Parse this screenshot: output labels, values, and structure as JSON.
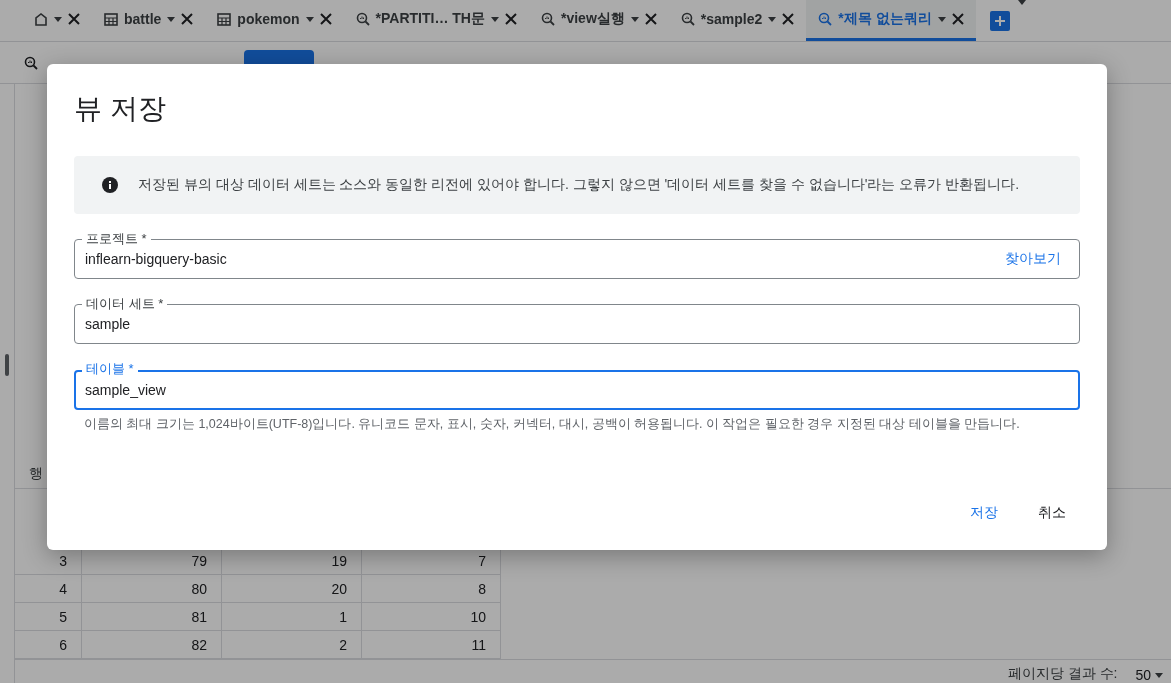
{
  "tabs": [
    {
      "kind": "home",
      "selected": false
    },
    {
      "kind": "table",
      "label": "battle",
      "selected": false
    },
    {
      "kind": "table",
      "label": "pokemon",
      "selected": false
    },
    {
      "kind": "query",
      "label": "*PARTITI… TH문",
      "selected": false
    },
    {
      "kind": "query",
      "label": "*view실행",
      "selected": false
    },
    {
      "kind": "query",
      "label": "*sample2",
      "selected": false
    },
    {
      "kind": "query",
      "label": "*제목 없는쿼리",
      "selected": true
    }
  ],
  "results": {
    "row_header": "행",
    "rows": [
      [
        "3",
        "79",
        "19",
        "7"
      ],
      [
        "4",
        "80",
        "20",
        "8"
      ],
      [
        "5",
        "81",
        "1",
        "10"
      ],
      [
        "6",
        "82",
        "2",
        "11"
      ]
    ],
    "page_size_label": "페이지당 결과 수:",
    "page_size": "50"
  },
  "dialog": {
    "title": "뷰 저장",
    "info": "저장된 뷰의 대상 데이터 세트는 소스와 동일한 리전에 있어야 합니다. 그렇지 않으면 '데이터 세트를 찾을 수 없습니다'라는 오류가 반환됩니다.",
    "fields": [
      {
        "label": "프로젝트 *",
        "value": "inflearn-bigquery-basic",
        "action": "찾아보기",
        "focused": false
      },
      {
        "label": "데이터 세트 *",
        "value": "sample",
        "focused": false
      },
      {
        "label": "테이블 *",
        "value": "sample_view",
        "focused": true,
        "hint": "이름의 최대 크기는 1,024바이트(UTF-8)입니다. 유니코드 문자, 표시, 숫자, 커넥터, 대시, 공백이 허용됩니다. 이 작업은 필요한 경우 지정된 대상 테이블을 만듭니다."
      }
    ],
    "buttons": [
      {
        "label": "저장",
        "primary": true
      },
      {
        "label": "취소",
        "primary": false
      }
    ]
  }
}
